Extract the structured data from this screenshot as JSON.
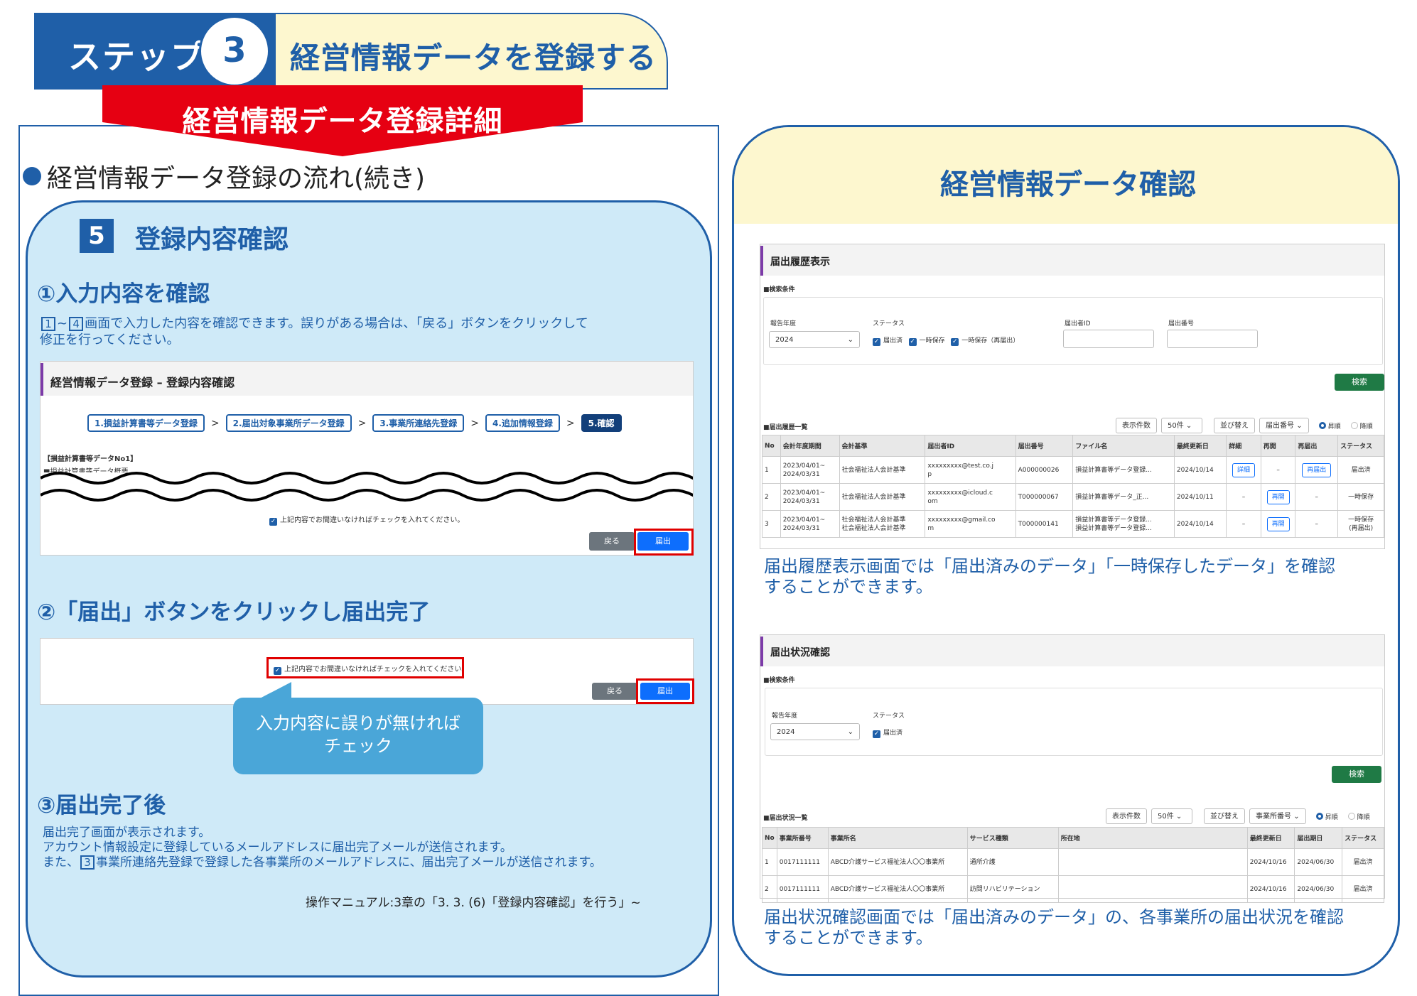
{
  "step": {
    "label": "ステップ",
    "number": "3",
    "title": "経営情報データを登録する"
  },
  "banner": {
    "title": "経営情報データ登録詳細"
  },
  "flow_heading": "経営情報データ登録の流れ(続き)",
  "section5": {
    "number": "5",
    "title": "登録内容確認",
    "sub1": {
      "title": "①入力内容を確認",
      "text_box_a": "1",
      "text_tilde": "~",
      "text_box_b": "4",
      "text_line1": "画面で入力した内容を確認できます。誤りがある場合は、「戻る」ボタンをクリックして",
      "text_line2": "修正を行ってください。"
    },
    "screen1": {
      "title": "経営情報データ登録 – 登録内容確認",
      "steps": [
        "1.損益計算書等データ登録",
        "2.届出対象事業所データ登録",
        "3.事業所連絡先登録",
        "4.追加情報登録",
        "5.確認"
      ],
      "step_sep": ">",
      "data_label": "【損益計算書等データNo1】",
      "data_sub": "■損益計算書等データ概要",
      "confirm_text": "上記内容でお間違いなければチェックを入れてください。",
      "back": "戻る",
      "submit": "届出"
    },
    "sub2": {
      "title": "②「届出」ボタンをクリックし届出完了"
    },
    "screen2": {
      "confirm_text": "上記内容でお間違いなければチェックを入れてください。",
      "back": "戻る",
      "submit": "届出"
    },
    "callout": {
      "line1": "入力内容に誤りが無ければ",
      "line2": "チェック"
    },
    "sub3": {
      "title": "③届出完了後",
      "line1": "届出完了画面が表示されます。",
      "line2": "アカウント情報設定に登録しているメールアドレスに届出完了メールが送信されます。",
      "line3_pre": "また、",
      "line3_box": "3",
      "line3_post": "事業所連絡先登録で登録した各事業所のメールアドレスに、届出完了メールが送信されます。"
    },
    "manual_ref": "操作マニュアル:3章の「3. 3. (6)「登録内容確認」を行う」~"
  },
  "right": {
    "title": "経営情報データ確認",
    "history": {
      "title": "届出履歴表示",
      "search_label": "■検索条件",
      "year_label": "報告年度",
      "year_value": "2024",
      "status_label": "ステータス",
      "status_options": [
        "届出済",
        "一時保存",
        "一時保存（再届出）"
      ],
      "id_label": "届出者ID",
      "number_label": "届出番号",
      "search_btn": "検索",
      "list_label": "■届出履歴一覧",
      "count_label": "表示件数",
      "count_value": "50件",
      "sort_label": "並び替え",
      "sort_value": "届出番号",
      "asc": "昇順",
      "desc": "降順",
      "headers": [
        "No",
        "会計年度期間",
        "会計基準",
        "届出者ID",
        "届出番号",
        "ファイル名",
        "最終更新日",
        "詳細",
        "再開",
        "再届出",
        "ステータス"
      ],
      "rows": [
        {
          "no": "1",
          "period1": "2023/04/01~",
          "period2": "2024/03/31",
          "std1": "社会福祉法人会計基準",
          "std2": "",
          "id1": "xxxxxxxxx@test.co.j",
          "id2": "p",
          "num": "A000000026",
          "file1": "損益計算書等データ登録...",
          "file2": "",
          "date": "2024/10/14",
          "detail": "詳細",
          "resume": "–",
          "refile": "再届出",
          "status1": "届出済",
          "status2": ""
        },
        {
          "no": "2",
          "period1": "2023/04/01~",
          "period2": "2024/03/31",
          "std1": "社会福祉法人会計基準",
          "std2": "",
          "id1": "xxxxxxxxx@icloud.c",
          "id2": "om",
          "num": "T000000067",
          "file1": "損益計算書等データ_正...",
          "file2": "",
          "date": "2024/10/11",
          "detail": "–",
          "resume": "再開",
          "refile": "–",
          "status1": "一時保存",
          "status2": ""
        },
        {
          "no": "3",
          "period1": "2023/04/01~",
          "period2": "2024/03/31",
          "std1": "社会福祉法人会計基準",
          "std2": "社会福祉法人会計基準",
          "id1": "xxxxxxxxx@gmail.co",
          "id2": "m",
          "num": "T000000141",
          "file1": "損益計算書等データ登録...",
          "file2": "損益計算書等データ登録...",
          "date": "2024/10/14",
          "detail": "–",
          "resume": "再開",
          "refile": "–",
          "status1": "一時保存",
          "status2": "(再届出)"
        }
      ]
    },
    "history_desc": {
      "line1": "届出履歴表示画面では「届出済みのデータ」「一時保存したデータ」を確認",
      "line2": "することができます。"
    },
    "status_screen": {
      "title": "届出状況確認",
      "search_label": "■検索条件",
      "year_label": "報告年度",
      "year_value": "2024",
      "status_label": "ステータス",
      "status_option": "届出済",
      "search_btn": "検索",
      "list_label": "■届出状況一覧",
      "count_label": "表示件数",
      "count_value": "50件",
      "sort_label": "並び替え",
      "sort_value": "事業所番号",
      "asc": "昇順",
      "desc": "降順",
      "headers": [
        "No",
        "事業所番号",
        "事業所名",
        "サービス種類",
        "所在地",
        "最終更新日",
        "届出期日",
        "ステータス"
      ],
      "rows": [
        {
          "no": "1",
          "code": "0017111111",
          "name": "ABCD介護サービス福祉法人〇〇事業所",
          "service": "通所介護",
          "address": "",
          "updated": "2024/10/16",
          "due": "2024/06/30",
          "status": "届出済"
        },
        {
          "no": "2",
          "code": "0017111111",
          "name": "ABCD介護サービス福祉法人〇〇事業所",
          "service": "訪問リハビリテーション",
          "address": "",
          "updated": "2024/10/16",
          "due": "2024/06/30",
          "status": "届出済"
        }
      ]
    },
    "status_desc": {
      "line1": "届出状況確認画面では「届出済みのデータ」の、各事業所の届出状況を確認",
      "line2": "することができます。"
    }
  },
  "colors": {
    "primary_blue": "#1f5fa8",
    "red_banner": "#e60012",
    "light_blue": "#cfeaf8",
    "light_yellow": "#fdf7cf",
    "green_button": "#1f7a45"
  }
}
